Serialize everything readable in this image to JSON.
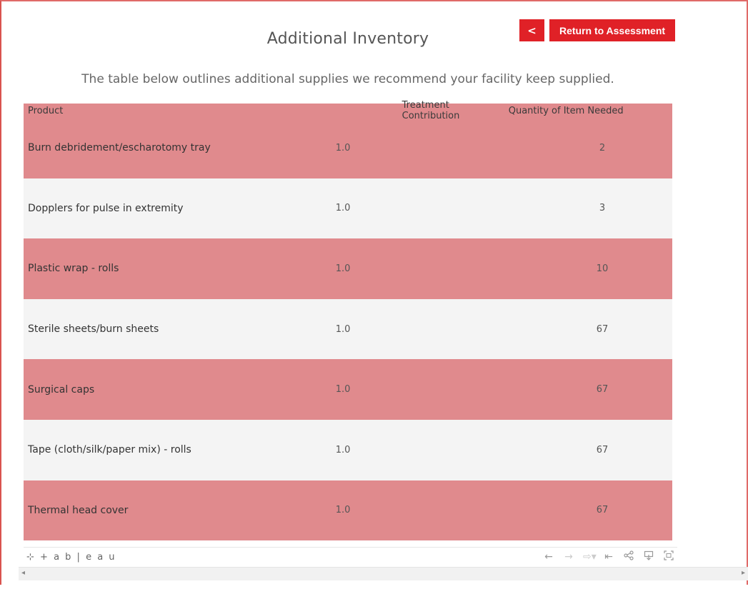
{
  "header": {
    "title": "Additional Inventory",
    "back_label": "<",
    "return_label": "Return to Assessment",
    "subtitle": "The table below outlines additional supplies we recommend your facility keep supplied."
  },
  "table": {
    "columns": [
      "Product",
      "Treatment Contribution",
      "Quantity of Item Needed"
    ],
    "rows": [
      {
        "product": "Burn debridement/escharotomy tray",
        "contribution": "1.0",
        "quantity": "2"
      },
      {
        "product": "Dopplers for pulse in extremity",
        "contribution": "1.0",
        "quantity": "3"
      },
      {
        "product": "Plastic wrap - rolls",
        "contribution": "1.0",
        "quantity": "10"
      },
      {
        "product": "Sterile sheets/burn sheets",
        "contribution": "1.0",
        "quantity": "67"
      },
      {
        "product": "Surgical caps",
        "contribution": "1.0",
        "quantity": "67"
      },
      {
        "product": "Tape (cloth/silk/paper mix) - rolls",
        "contribution": "1.0",
        "quantity": "67"
      },
      {
        "product": "Thermal head cover",
        "contribution": "1.0",
        "quantity": "67"
      }
    ]
  },
  "toolbar": {
    "logo": "+ a b | e a u",
    "icons": [
      "undo-icon",
      "redo-icon",
      "revert-icon",
      "revert-all-icon",
      "share-icon",
      "download-icon",
      "fullscreen-icon"
    ]
  },
  "colors": {
    "accent": "#e02127",
    "row_highlight": "#e08a8d",
    "row_alt": "#f4f4f4"
  }
}
